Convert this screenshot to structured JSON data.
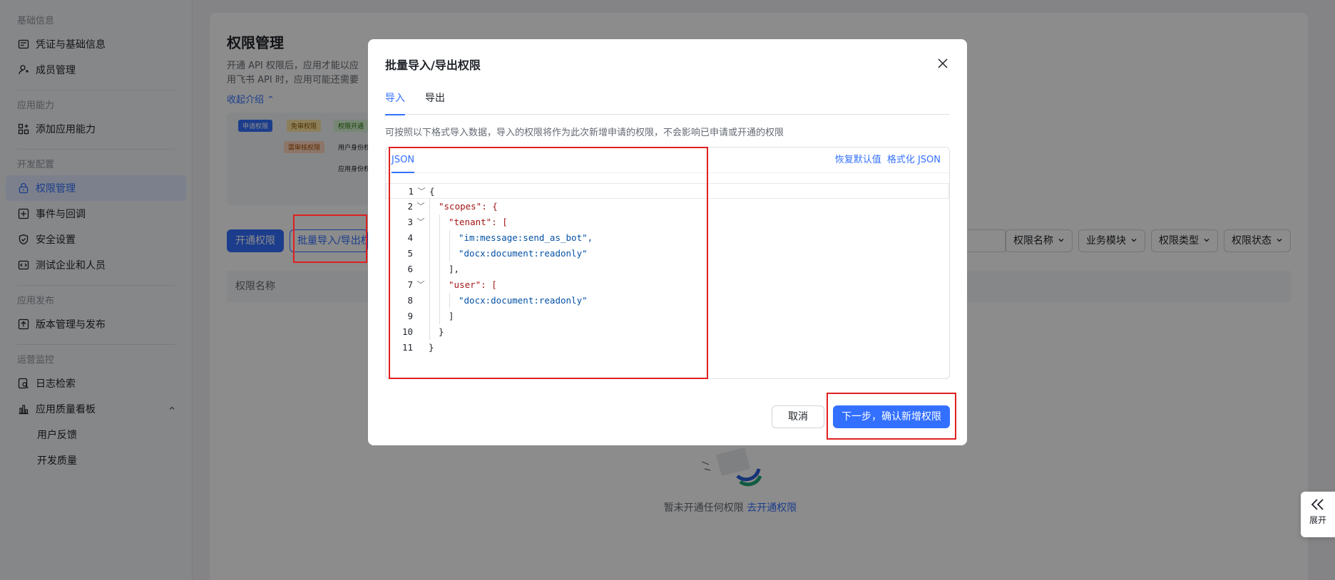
{
  "sidebar": {
    "groups": [
      {
        "title": "基础信息",
        "items": [
          {
            "label": "凭证与基础信息",
            "icon": "credential-icon"
          },
          {
            "label": "成员管理",
            "icon": "user-add-icon"
          }
        ]
      },
      {
        "title": "应用能力",
        "items": [
          {
            "label": "添加应用能力",
            "icon": "apps-add-icon"
          }
        ]
      },
      {
        "title": "开发配置",
        "items": [
          {
            "label": "权限管理",
            "icon": "lock-icon",
            "active": true
          },
          {
            "label": "事件与回调",
            "icon": "event-icon"
          },
          {
            "label": "安全设置",
            "icon": "shield-icon"
          },
          {
            "label": "测试企业和人员",
            "icon": "test-icon"
          }
        ]
      },
      {
        "title": "应用发布",
        "items": [
          {
            "label": "版本管理与发布",
            "icon": "upload-icon"
          }
        ]
      },
      {
        "title": "运营监控",
        "items": [
          {
            "label": "日志检索",
            "icon": "log-search-icon"
          },
          {
            "label": "应用质量看板",
            "icon": "bar-chart-icon"
          },
          {
            "label": "用户反馈"
          },
          {
            "label": "开发质量"
          }
        ]
      }
    ]
  },
  "main": {
    "title": "权限管理",
    "desc_line1": "开通 API 权限后，应用才能以应",
    "desc_line2": "用飞书 API 时，应用可能还需要",
    "collapse_label": "收起介绍",
    "flow": {
      "apply": "申请权限",
      "free": "免审权限",
      "open": "权限开通",
      "review": "需审核权限",
      "user_identity": "用户身份权限",
      "app_identity": "应用身份权限"
    },
    "open_permission_button": "开通权限",
    "bulk_button": "批量导入/导出权限",
    "filters": [
      "权限名称",
      "业务模块",
      "权限类型",
      "权限状态"
    ],
    "table_header": "权限名称",
    "empty_text": "暂未开通任何权限",
    "empty_link": "去开通权限"
  },
  "modal": {
    "title": "批量导入/导出权限",
    "tabs": [
      "导入",
      "导出"
    ],
    "hint": "可按照以下格式导入数据，导入的权限将作为此次新增申请的权限，不会影响已申请或开通的权限",
    "editor_tab": "JSON",
    "restore_default": "恢复默认值",
    "format_json": "格式化 JSON",
    "cancel": "取消",
    "next": "下一步，确认新增权限"
  },
  "code_lines": [
    {
      "n": "1",
      "text": "{"
    },
    {
      "n": "2",
      "text": "\"scopes\": {"
    },
    {
      "n": "3",
      "text": "\"tenant\": ["
    },
    {
      "n": "4",
      "text": "\"im:message:send_as_bot\","
    },
    {
      "n": "5",
      "text": "\"docx:document:readonly\""
    },
    {
      "n": "6",
      "text": "],"
    },
    {
      "n": "7",
      "text": "\"user\": ["
    },
    {
      "n": "8",
      "text": "\"docx:document:readonly\""
    },
    {
      "n": "9",
      "text": "]"
    },
    {
      "n": "10",
      "text": "}"
    },
    {
      "n": "11",
      "text": "}"
    }
  ],
  "expand_label": "展开"
}
